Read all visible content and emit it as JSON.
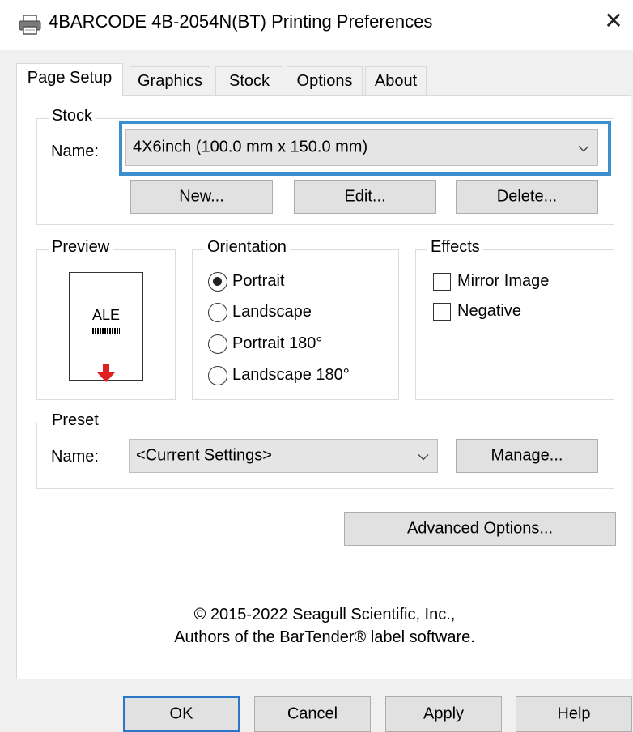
{
  "window": {
    "title": "4BARCODE 4B-2054N(BT) Printing Preferences",
    "close_glyph": "✕",
    "icon": "printer-icon"
  },
  "tabs": [
    {
      "label": "Page Setup",
      "active": true
    },
    {
      "label": "Graphics",
      "active": false
    },
    {
      "label": "Stock",
      "active": false
    },
    {
      "label": "Options",
      "active": false
    },
    {
      "label": "About",
      "active": false
    }
  ],
  "stock": {
    "group_label": "Stock",
    "name_label": "Name:",
    "selected": "4X6inch (100.0 mm x 150.0 mm)",
    "new_label": "New...",
    "edit_label": "Edit...",
    "delete_label": "Delete..."
  },
  "preview": {
    "group_label": "Preview",
    "sample_text": "ALE"
  },
  "orientation": {
    "group_label": "Orientation",
    "options": [
      {
        "label": "Portrait",
        "checked": true
      },
      {
        "label": "Landscape",
        "checked": false
      },
      {
        "label": "Portrait 180°",
        "checked": false
      },
      {
        "label": "Landscape 180°",
        "checked": false
      }
    ]
  },
  "effects": {
    "group_label": "Effects",
    "options": [
      {
        "label": "Mirror Image",
        "checked": false
      },
      {
        "label": "Negative",
        "checked": false
      }
    ]
  },
  "preset": {
    "group_label": "Preset",
    "name_label": "Name:",
    "selected": "<Current Settings>",
    "manage_label": "Manage..."
  },
  "advanced_label": "Advanced Options...",
  "copyright": {
    "line1": "© 2015-2022 Seagull Scientific, Inc.,",
    "line2": "Authors of the BarTender® label software."
  },
  "footer": {
    "ok_label": "OK",
    "cancel_label": "Cancel",
    "apply_label": "Apply",
    "help_label": "Help"
  },
  "colors": {
    "focus_ring": "#3c8fce",
    "default_button_border": "#2b77c7",
    "arrow": "#e02020"
  }
}
